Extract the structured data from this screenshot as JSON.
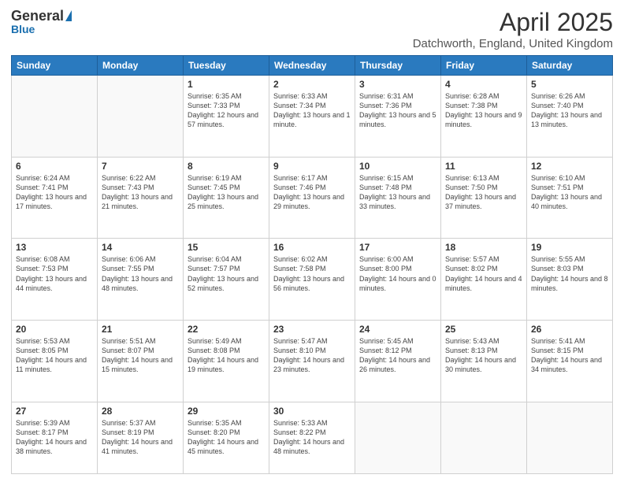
{
  "logo": {
    "general": "General",
    "blue": "Blue"
  },
  "header": {
    "title": "April 2025",
    "subtitle": "Datchworth, England, United Kingdom"
  },
  "days": [
    "Sunday",
    "Monday",
    "Tuesday",
    "Wednesday",
    "Thursday",
    "Friday",
    "Saturday"
  ],
  "weeks": [
    [
      {
        "date": "",
        "info": ""
      },
      {
        "date": "",
        "info": ""
      },
      {
        "date": "1",
        "info": "Sunrise: 6:35 AM\nSunset: 7:33 PM\nDaylight: 12 hours and 57 minutes."
      },
      {
        "date": "2",
        "info": "Sunrise: 6:33 AM\nSunset: 7:34 PM\nDaylight: 13 hours and 1 minute."
      },
      {
        "date": "3",
        "info": "Sunrise: 6:31 AM\nSunset: 7:36 PM\nDaylight: 13 hours and 5 minutes."
      },
      {
        "date": "4",
        "info": "Sunrise: 6:28 AM\nSunset: 7:38 PM\nDaylight: 13 hours and 9 minutes."
      },
      {
        "date": "5",
        "info": "Sunrise: 6:26 AM\nSunset: 7:40 PM\nDaylight: 13 hours and 13 minutes."
      }
    ],
    [
      {
        "date": "6",
        "info": "Sunrise: 6:24 AM\nSunset: 7:41 PM\nDaylight: 13 hours and 17 minutes."
      },
      {
        "date": "7",
        "info": "Sunrise: 6:22 AM\nSunset: 7:43 PM\nDaylight: 13 hours and 21 minutes."
      },
      {
        "date": "8",
        "info": "Sunrise: 6:19 AM\nSunset: 7:45 PM\nDaylight: 13 hours and 25 minutes."
      },
      {
        "date": "9",
        "info": "Sunrise: 6:17 AM\nSunset: 7:46 PM\nDaylight: 13 hours and 29 minutes."
      },
      {
        "date": "10",
        "info": "Sunrise: 6:15 AM\nSunset: 7:48 PM\nDaylight: 13 hours and 33 minutes."
      },
      {
        "date": "11",
        "info": "Sunrise: 6:13 AM\nSunset: 7:50 PM\nDaylight: 13 hours and 37 minutes."
      },
      {
        "date": "12",
        "info": "Sunrise: 6:10 AM\nSunset: 7:51 PM\nDaylight: 13 hours and 40 minutes."
      }
    ],
    [
      {
        "date": "13",
        "info": "Sunrise: 6:08 AM\nSunset: 7:53 PM\nDaylight: 13 hours and 44 minutes."
      },
      {
        "date": "14",
        "info": "Sunrise: 6:06 AM\nSunset: 7:55 PM\nDaylight: 13 hours and 48 minutes."
      },
      {
        "date": "15",
        "info": "Sunrise: 6:04 AM\nSunset: 7:57 PM\nDaylight: 13 hours and 52 minutes."
      },
      {
        "date": "16",
        "info": "Sunrise: 6:02 AM\nSunset: 7:58 PM\nDaylight: 13 hours and 56 minutes."
      },
      {
        "date": "17",
        "info": "Sunrise: 6:00 AM\nSunset: 8:00 PM\nDaylight: 14 hours and 0 minutes."
      },
      {
        "date": "18",
        "info": "Sunrise: 5:57 AM\nSunset: 8:02 PM\nDaylight: 14 hours and 4 minutes."
      },
      {
        "date": "19",
        "info": "Sunrise: 5:55 AM\nSunset: 8:03 PM\nDaylight: 14 hours and 8 minutes."
      }
    ],
    [
      {
        "date": "20",
        "info": "Sunrise: 5:53 AM\nSunset: 8:05 PM\nDaylight: 14 hours and 11 minutes."
      },
      {
        "date": "21",
        "info": "Sunrise: 5:51 AM\nSunset: 8:07 PM\nDaylight: 14 hours and 15 minutes."
      },
      {
        "date": "22",
        "info": "Sunrise: 5:49 AM\nSunset: 8:08 PM\nDaylight: 14 hours and 19 minutes."
      },
      {
        "date": "23",
        "info": "Sunrise: 5:47 AM\nSunset: 8:10 PM\nDaylight: 14 hours and 23 minutes."
      },
      {
        "date": "24",
        "info": "Sunrise: 5:45 AM\nSunset: 8:12 PM\nDaylight: 14 hours and 26 minutes."
      },
      {
        "date": "25",
        "info": "Sunrise: 5:43 AM\nSunset: 8:13 PM\nDaylight: 14 hours and 30 minutes."
      },
      {
        "date": "26",
        "info": "Sunrise: 5:41 AM\nSunset: 8:15 PM\nDaylight: 14 hours and 34 minutes."
      }
    ],
    [
      {
        "date": "27",
        "info": "Sunrise: 5:39 AM\nSunset: 8:17 PM\nDaylight: 14 hours and 38 minutes."
      },
      {
        "date": "28",
        "info": "Sunrise: 5:37 AM\nSunset: 8:19 PM\nDaylight: 14 hours and 41 minutes."
      },
      {
        "date": "29",
        "info": "Sunrise: 5:35 AM\nSunset: 8:20 PM\nDaylight: 14 hours and 45 minutes."
      },
      {
        "date": "30",
        "info": "Sunrise: 5:33 AM\nSunset: 8:22 PM\nDaylight: 14 hours and 48 minutes."
      },
      {
        "date": "",
        "info": ""
      },
      {
        "date": "",
        "info": ""
      },
      {
        "date": "",
        "info": ""
      }
    ]
  ]
}
